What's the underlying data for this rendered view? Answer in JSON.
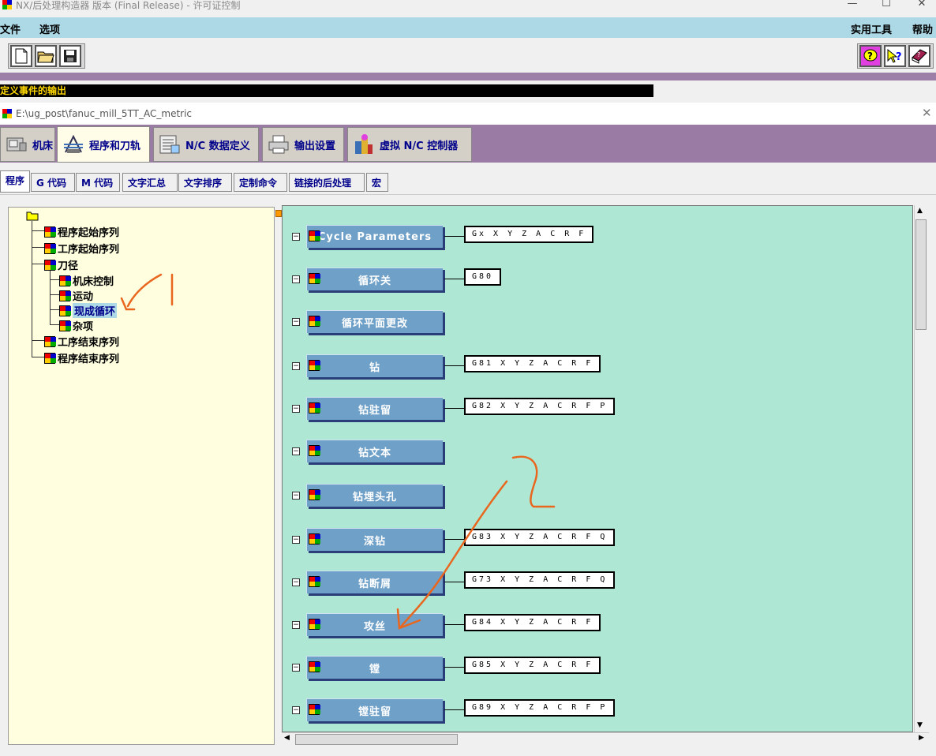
{
  "app": {
    "title": "NX/后处理构造器 版本 (Final Release) - 许可证控制",
    "window_controls": [
      "—",
      "☐",
      "✕"
    ]
  },
  "menu": {
    "left": [
      "文件",
      "选项"
    ],
    "right": [
      "实用工具",
      "帮助"
    ]
  },
  "toolbar": {
    "left_buttons": [
      "new-file-icon",
      "open-folder-icon",
      "save-icon"
    ],
    "right_buttons": [
      "help-balloon-icon",
      "whats-this-icon",
      "manual-book-icon"
    ]
  },
  "status_line": "定义事件的输出",
  "inner_window": {
    "path": "E:\\ug_post\\fanuc_mill_5TT_AC_metric",
    "close": "✕"
  },
  "main_tabs": [
    {
      "label": "机床",
      "icon": "machine-icon"
    },
    {
      "label": "程序和刀轨",
      "icon": "program-path-icon",
      "active": true
    },
    {
      "label": "N/C 数据定义",
      "icon": "nc-data-icon"
    },
    {
      "label": "输出设置",
      "icon": "printer-icon"
    },
    {
      "label": "虚拟 N/C 控制器",
      "icon": "vnc-icon"
    }
  ],
  "sub_tabs": [
    {
      "label": "程序",
      "active": true
    },
    {
      "label": "G 代码"
    },
    {
      "label": "M 代码"
    },
    {
      "label": "文字汇总"
    },
    {
      "label": "文字排序"
    },
    {
      "label": "定制命令"
    },
    {
      "label": "链接的后处理"
    },
    {
      "label": "宏"
    }
  ],
  "tree": {
    "root_icon": "folder-icon",
    "nodes": [
      {
        "label": "程序起始序列",
        "level": 1
      },
      {
        "label": "工序起始序列",
        "level": 1
      },
      {
        "label": "刀径",
        "level": 1
      },
      {
        "label": "机床控制",
        "level": 2
      },
      {
        "label": "运动",
        "level": 2
      },
      {
        "label": "现成循环",
        "level": 2,
        "selected": true
      },
      {
        "label": "杂项",
        "level": 2
      },
      {
        "label": "工序结束序列",
        "level": 1
      },
      {
        "label": "程序结束序列",
        "level": 1
      }
    ]
  },
  "events": [
    {
      "label": "Cycle Parameters",
      "code": "Gx X Y Z A C R F"
    },
    {
      "label": "循环关",
      "code": "G80"
    },
    {
      "label": "循环平面更改",
      "code": ""
    },
    {
      "label": "钻",
      "code": "G81 X Y Z A C R F"
    },
    {
      "label": "钻驻留",
      "code": "G82 X Y Z A C R F P"
    },
    {
      "label": "钻文本",
      "code": ""
    },
    {
      "label": "钻埋头孔",
      "code": ""
    },
    {
      "label": "深钻",
      "code": "G83 X Y Z A C R F Q"
    },
    {
      "label": "钻断屑",
      "code": "G73 X Y Z A C R F Q"
    },
    {
      "label": "攻丝",
      "code": "G84 X Y Z A C R F"
    },
    {
      "label": "镗",
      "code": "G85 X Y Z A C R F"
    },
    {
      "label": "镗驻留",
      "code": "G89 X Y Z A C R F P"
    }
  ],
  "annotations": {
    "color": "#e8661e",
    "marks": [
      "1",
      "2"
    ]
  },
  "colors": {
    "menu_bg": "#add8e6",
    "tab_band": "#9a7ba3",
    "tree_bg": "#ffffe0",
    "canvas_bg": "#aee8d4",
    "event_button": "#6fa0c8"
  }
}
